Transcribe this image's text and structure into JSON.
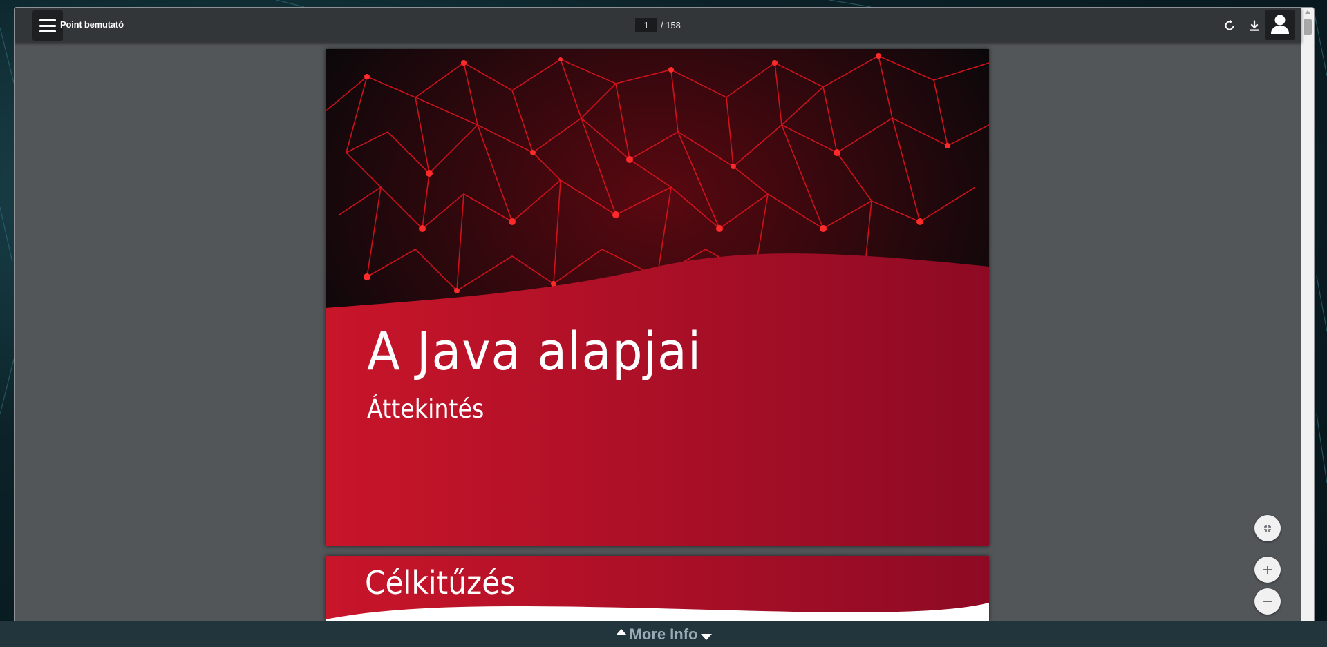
{
  "viewer": {
    "title": "Point bemutató",
    "current_page": "1",
    "total_pages": "/ 158"
  },
  "icons": {
    "menu": "menu-icon",
    "rotate": "rotate-icon",
    "download": "download-icon",
    "user": "user-icon",
    "fit": "fit-page-icon",
    "zoom_in": "zoom-in-icon",
    "zoom_out": "zoom-out-icon"
  },
  "slides": [
    {
      "title": "A Java alapjai",
      "subtitle": "Áttekintés"
    },
    {
      "title": "Célkitűzés"
    }
  ],
  "footer": {
    "more_info": "More Info"
  },
  "colors": {
    "toolbar": "#323639",
    "viewer_bg": "#525659",
    "slide_red_start": "#c8152a",
    "slide_red_end": "#8e0a24",
    "footer_bar": "#22353d",
    "footer_text": "#9aa9b3"
  }
}
